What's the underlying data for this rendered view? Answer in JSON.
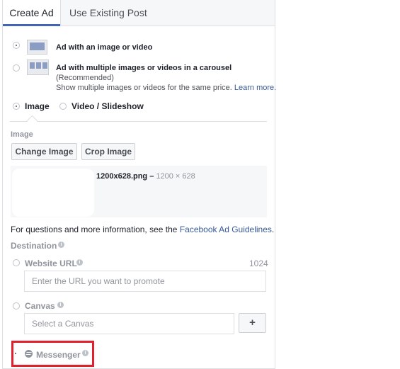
{
  "tabs": [
    {
      "label": "Create Ad",
      "active": true
    },
    {
      "label": "Use Existing Post",
      "active": false
    }
  ],
  "format_options": [
    {
      "title": "Ad with an image or video",
      "subtitle": "",
      "description": "",
      "selected": true
    },
    {
      "title": "Ad with multiple images or videos in a carousel",
      "subtitle": "(Recommended)",
      "description": "Show multiple images or videos for the same price.",
      "link": "Learn more.",
      "selected": false
    }
  ],
  "media_type": {
    "options": [
      {
        "label": "Image",
        "selected": true
      },
      {
        "label": "Video / Slideshow",
        "selected": false
      }
    ]
  },
  "image_section": {
    "heading": "Image",
    "change_button": "Change Image",
    "crop_button": "Crop Image",
    "file_name": "1200x628.png –",
    "dimensions": "1200 × 628"
  },
  "guidelines": {
    "text": "For questions and more information, see the",
    "link": "Facebook Ad Guidelines",
    "end": "."
  },
  "destination": {
    "heading": "Destination",
    "website": {
      "label": "Website URL",
      "char_count": "1024",
      "placeholder": "Enter the URL you want to promote"
    },
    "canvas": {
      "label": "Canvas",
      "placeholder": "Select a Canvas",
      "add_button": "+"
    },
    "messenger": {
      "label": "Messenger",
      "selected": true
    }
  },
  "colors": {
    "accent": "#4267b2",
    "link": "#365899",
    "highlight": "#e0212d"
  }
}
